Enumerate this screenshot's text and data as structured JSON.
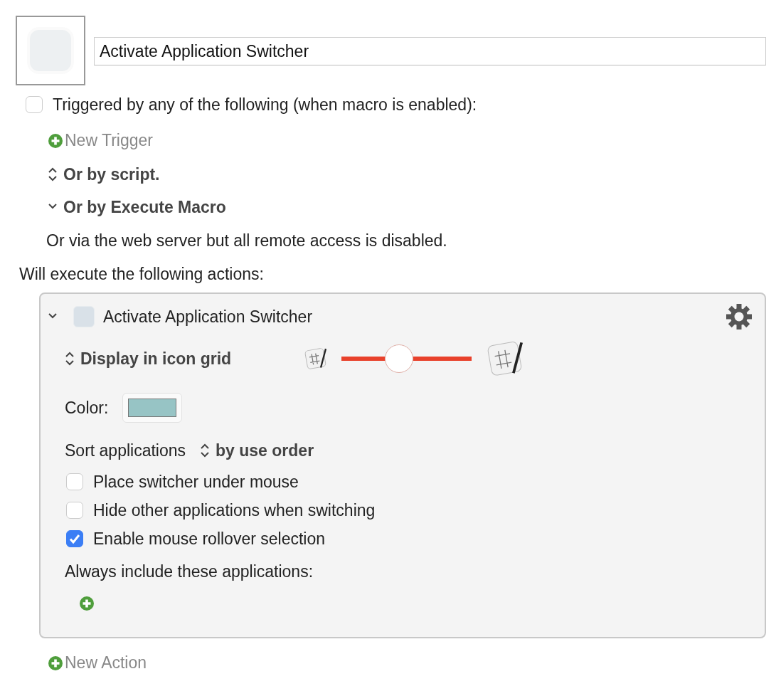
{
  "macro": {
    "name": "Activate Application Switcher"
  },
  "trigger": {
    "label": "Triggered by any of the following (when macro is enabled):",
    "checked": false
  },
  "new_trigger": "New Trigger",
  "options": [
    {
      "kind": "stepper",
      "label": "Or by script."
    },
    {
      "kind": "disclosure",
      "label": "Or by Execute Macro",
      "expanded": true
    }
  ],
  "web_server_note": "Or via the web server but all remote access is disabled.",
  "actions_heading": "Will execute the following actions:",
  "action": {
    "title": "Activate Application Switcher",
    "expanded": true,
    "display_mode": "Display in icon grid",
    "icon_size": {
      "level": 0.44
    },
    "color_label": "Color:",
    "color": "#97c4c5",
    "sort_label": "Sort applications",
    "sort_value": "by use order",
    "checkboxes": [
      {
        "label": "Place switcher under mouse",
        "checked": false
      },
      {
        "label": "Hide other applications when switching",
        "checked": false
      },
      {
        "label": "Enable mouse rollover selection",
        "checked": true
      }
    ],
    "include_label": "Always include these applications:"
  },
  "new_action": "New Action"
}
